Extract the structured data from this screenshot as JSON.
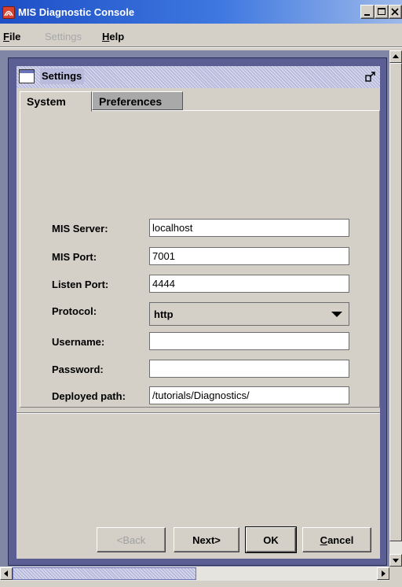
{
  "window": {
    "title": "MIS Diagnostic Console",
    "icon": "app-icon"
  },
  "menu": {
    "file": {
      "label": "File",
      "mnemonic": "F",
      "rest": "ile"
    },
    "settings": {
      "label": "Settings"
    },
    "help": {
      "label": "Help",
      "mnemonic": "H",
      "rest": "elp"
    }
  },
  "frame": {
    "title": "Settings"
  },
  "tabs": [
    {
      "label": "System",
      "selected": true
    },
    {
      "label": "Preferences",
      "selected": false
    }
  ],
  "form": {
    "mis_server": {
      "label": "MIS Server:",
      "value": "localhost"
    },
    "mis_port": {
      "label": "MIS Port:",
      "value": "7001"
    },
    "listen_port": {
      "label": "Listen Port:",
      "value": "4444"
    },
    "protocol": {
      "label": "Protocol:",
      "value": "http"
    },
    "username": {
      "label": "Username:",
      "value": ""
    },
    "password": {
      "label": "Password:",
      "value": ""
    },
    "deployed_path": {
      "label": "Deployed path:",
      "value": "/tutorials/Diagnostics/"
    }
  },
  "buttons": {
    "back": "<Back",
    "next": "Next>",
    "ok": "OK",
    "cancel": {
      "mnemonic": "C",
      "rest": "ancel"
    }
  },
  "colors": {
    "titlebar": "#1d4fc6",
    "frame_border": "#5a5e92",
    "desktop": "#7f86a6"
  }
}
